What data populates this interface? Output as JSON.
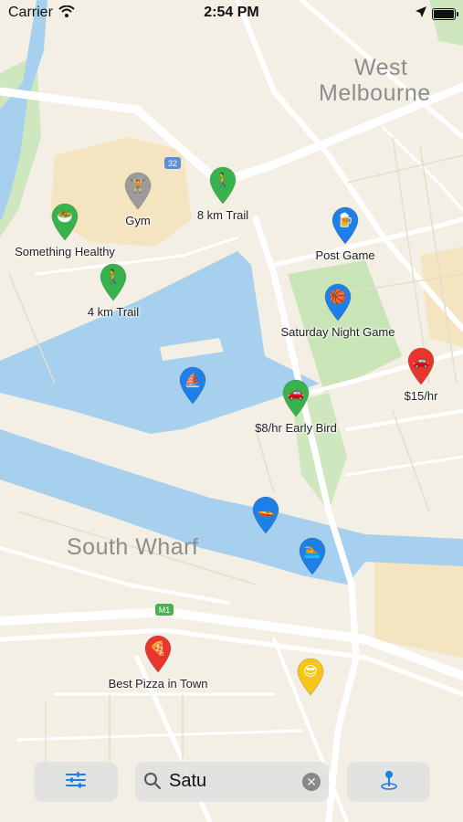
{
  "status_bar": {
    "carrier": "Carrier",
    "time": "2:54 PM"
  },
  "map": {
    "area_labels": [
      "West",
      "Melbourne",
      "South Wharf"
    ],
    "road_shields": [
      "32",
      "M1"
    ],
    "pois": [
      {
        "label": "Gym",
        "icon": "dumbbell-icon",
        "color": "#9b9b9b",
        "glyph": "🏋"
      },
      {
        "label": "8 km Trail",
        "icon": "walker-icon",
        "color": "#37b24d",
        "glyph": "🚶"
      },
      {
        "label": "Something Healthy",
        "icon": "salad-icon",
        "color": "#37b24d",
        "glyph": "🥗"
      },
      {
        "label": "Post Game",
        "icon": "beer-icon",
        "color": "#1e7fe8",
        "glyph": "🍺"
      },
      {
        "label": "4 km Trail",
        "icon": "walker-icon",
        "color": "#37b24d",
        "glyph": "🚶"
      },
      {
        "label": "Saturday Night Game",
        "icon": "basketball-icon",
        "color": "#1e7fe8",
        "glyph": "🏀"
      },
      {
        "label": "$15/hr",
        "icon": "car-icon",
        "color": "#e8362e",
        "glyph": "🚗"
      },
      {
        "label": "",
        "icon": "sailboat-icon",
        "color": "#1e7fe8",
        "glyph": "⛵"
      },
      {
        "label": "$8/hr Early Bird",
        "icon": "car-icon",
        "color": "#37b24d",
        "glyph": "🚗"
      },
      {
        "label": "",
        "icon": "speedboat-icon",
        "color": "#1e7fe8",
        "glyph": "🚤"
      },
      {
        "label": "",
        "icon": "swimmer-icon",
        "color": "#1e7fe8",
        "glyph": "🏊"
      },
      {
        "label": "Best Pizza in Town",
        "icon": "pizza-icon",
        "color": "#e8362e",
        "glyph": "🍕"
      },
      {
        "label": "",
        "icon": "sunglasses-face-icon",
        "color": "#f5c518",
        "glyph": "😎"
      }
    ]
  },
  "toolbar": {
    "filter_icon": "sliders-icon",
    "search_value": "Satu",
    "search_icon": "magnifier-icon",
    "clear_icon": "clear-circle-icon",
    "location_icon": "location-pin-icon",
    "accent": "#1e7fe8"
  }
}
